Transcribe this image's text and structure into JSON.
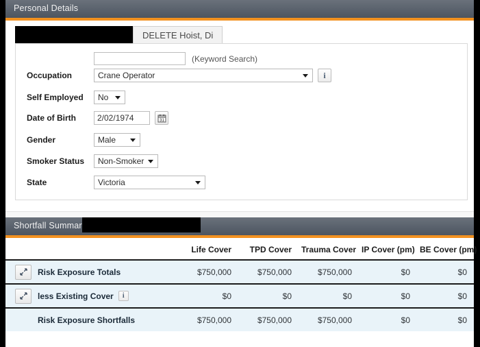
{
  "personal_details": {
    "header_title": "Personal Details",
    "tabs": [
      {
        "label": "",
        "redacted": true
      },
      {
        "label": "DELETE Hoist, Di",
        "redacted": false
      }
    ],
    "fields": {
      "occupation": {
        "label": "Occupation",
        "keyword_value": "",
        "keyword_placeholder": "",
        "keyword_hint": "(Keyword Search)",
        "selected": "Crane Operator",
        "info_glyph": "i"
      },
      "self_employed": {
        "label": "Self Employed",
        "selected": "No"
      },
      "date_of_birth": {
        "label": "Date of Birth",
        "value": "2/02/1974",
        "calendar_day": "31"
      },
      "gender": {
        "label": "Gender",
        "selected": "Male"
      },
      "smoker_status": {
        "label": "Smoker Status",
        "selected": "Non-Smoker"
      },
      "state": {
        "label": "State",
        "selected": "Victoria"
      }
    }
  },
  "shortfall_summary": {
    "header_title": "Shortfall Summary",
    "columns": [
      "",
      "Life Cover",
      "TPD Cover",
      "Trauma Cover",
      "IP Cover (pm)",
      "BE Cover (pm)"
    ],
    "rows": [
      {
        "label": "Risk Exposure Totals",
        "has_expand": true,
        "has_info": false,
        "values": [
          "$750,000",
          "$750,000",
          "$750,000",
          "$0",
          "$0"
        ]
      },
      {
        "label": "less Existing Cover",
        "has_expand": true,
        "has_info": true,
        "info_glyph": "i",
        "values": [
          "$0",
          "$0",
          "$0",
          "$0",
          "$0"
        ]
      },
      {
        "label": "Risk Exposure Shortfalls",
        "has_expand": false,
        "has_info": false,
        "values": [
          "$750,000",
          "$750,000",
          "$750,000",
          "$0",
          "$0"
        ]
      }
    ]
  },
  "colors": {
    "header_bar": "#5b636e",
    "accent_orange": "#f29120",
    "row_tint": "#e9f3f9",
    "redaction": "#000000"
  }
}
